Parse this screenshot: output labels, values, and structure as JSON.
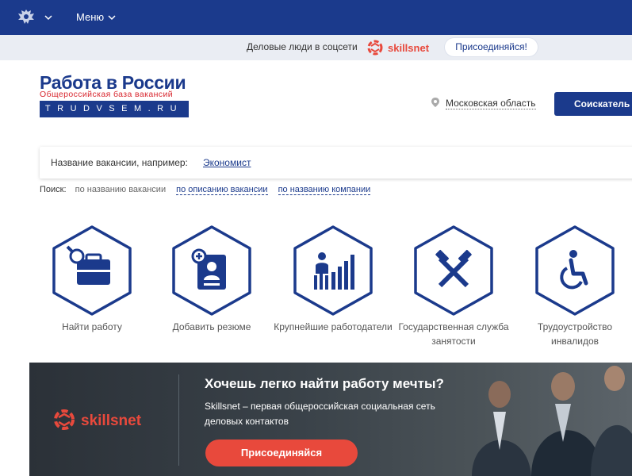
{
  "colors": {
    "brand_blue": "#1b3a8c",
    "accent_red": "#d8262e",
    "cta_red": "#e8493c",
    "banner_dark": "#2b3138"
  },
  "topbar": {
    "emblem_icon": "coat-of-arms-icon",
    "menu_label": "Меню"
  },
  "social_strip": {
    "text": "Деловые люди в соцсети",
    "logo_text": "skillsnet",
    "join_label": "Присоединяйся!"
  },
  "logo": {
    "title": "Работа в России",
    "subtitle": "Общероссийская база вакансий",
    "domain": "TRUDVSEM.RU"
  },
  "header": {
    "region": "Московская область",
    "seeker_button": "Соискатель"
  },
  "search": {
    "hint": "Название вакансии, например:",
    "example": "Экономист",
    "modes_label": "Поиск:",
    "modes": [
      "по названию вакансии",
      "по описанию вакансии",
      "по названию компании"
    ]
  },
  "tiles": [
    {
      "icon": "briefcase-search-icon",
      "label": "Найти работу"
    },
    {
      "icon": "add-resume-icon",
      "label": "Добавить резюме"
    },
    {
      "icon": "top-employers-chart-icon",
      "label": "Крупнейшие работодатели"
    },
    {
      "icon": "hammers-icon",
      "label": "Государственная служба занятости"
    },
    {
      "icon": "wheelchair-icon",
      "label": "Трудоустройство инвалидов"
    }
  ],
  "banner": {
    "logo_text": "skillsnet",
    "title": "Хочешь легко найти работу мечты?",
    "description": "Skillsnet – первая общероссийская социальная сеть деловых контактов",
    "cta": "Присоединяйся"
  }
}
